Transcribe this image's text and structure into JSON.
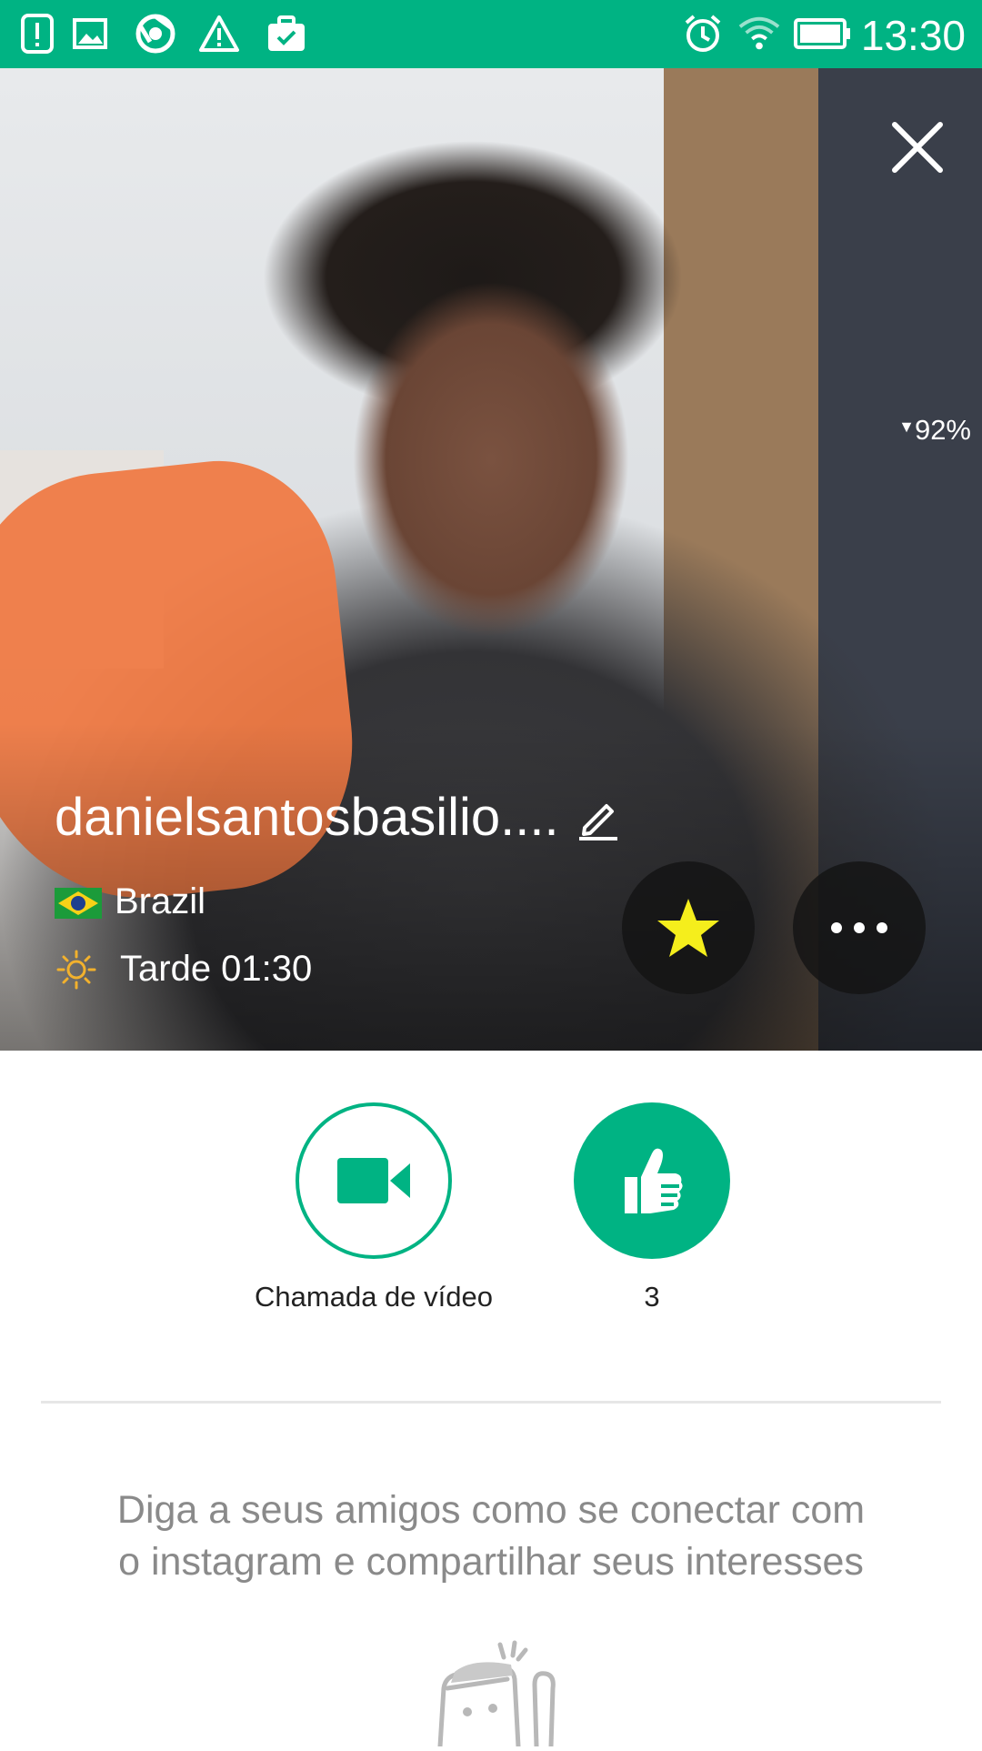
{
  "status_bar": {
    "time": "13:30",
    "icons_left": [
      "alert-icon",
      "image-icon",
      "chrome-icon",
      "warning-icon",
      "briefcase-check-icon"
    ],
    "icons_right": [
      "alarm-icon",
      "wifi-icon",
      "battery-icon"
    ]
  },
  "profile": {
    "signal_percent": "92%",
    "username": "danielsantosbasilio....",
    "country": "Brazil",
    "local_time": "Tarde 01:30"
  },
  "actions": {
    "video_call_label": "Chamada de vídeo",
    "likes_count": "3"
  },
  "promo_text": "Diga a seus amigos como se conectar com o instagram e compartilhar seus interesses",
  "colors": {
    "accent": "#00b383",
    "star": "#f5ee1c"
  }
}
